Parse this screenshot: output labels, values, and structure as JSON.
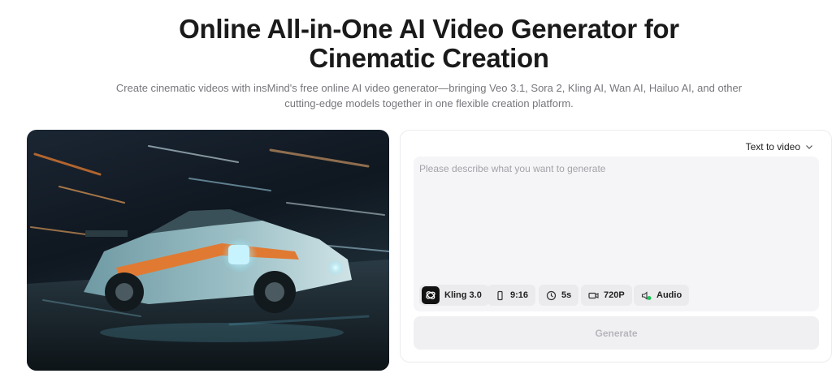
{
  "header": {
    "title_line1": "Online All-in-One AI Video Generator for",
    "title_line2": "Cinematic Creation",
    "subtitle_line1": "Create cinematic videos with insMind's free online AI video generator—bringing Veo 3.1, Sora 2, Kling AI, Wan AI, Hailuo AI, and other",
    "subtitle_line2": "cutting-edge models together in one flexible creation platform."
  },
  "hero": {
    "image_icon": "race-car-photo"
  },
  "generator": {
    "mode": "Text to video",
    "mode_icon": "chevron-down-icon",
    "prompt": {
      "value": "",
      "placeholder": "Please describe what you want to generate"
    },
    "options": {
      "model": "Kling 3.0",
      "aspect_ratio": "9:16",
      "duration": "5s",
      "resolution": "720P",
      "audio": "Audio"
    },
    "generate_label": "Generate"
  },
  "colors": {
    "text_primary": "#1a1a1a",
    "text_secondary": "#76767c",
    "chip_bg": "#ebebee",
    "input_bg": "#f5f5f7",
    "button_disabled_bg": "#f0f0f2",
    "button_disabled_text": "#b6b6bc",
    "audio_accent": "#22c55e"
  }
}
